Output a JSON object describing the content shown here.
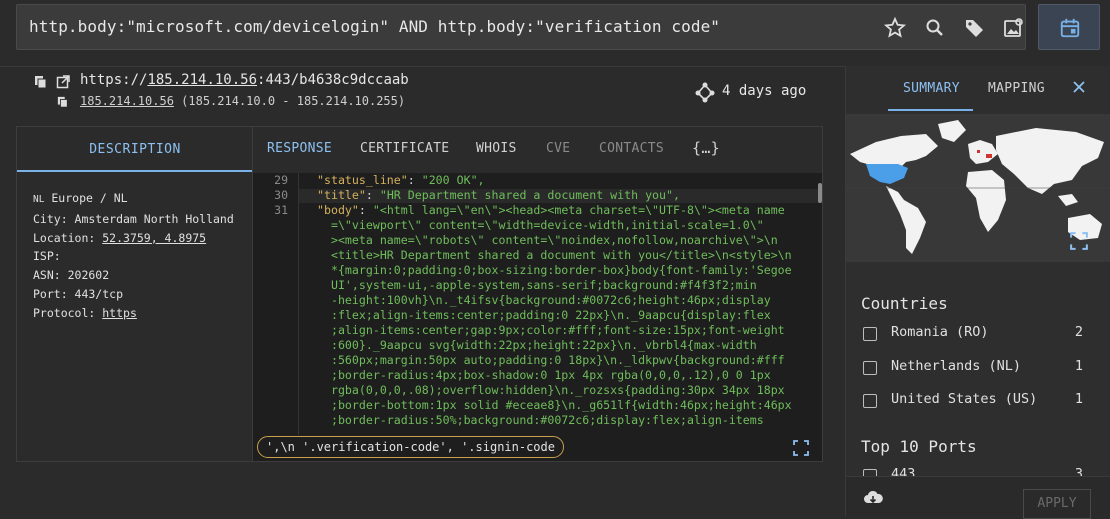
{
  "search": {
    "query": "http.body:\"microsoft.com/devicelogin\" AND http.body:\"verification code\""
  },
  "host": {
    "url_prefix": "https://",
    "url_ip": "185.214.10.56",
    "url_suffix": ":443/b4638c9dccaab",
    "sub_ip": "185.214.10.56",
    "sub_range": " (185.214.10.0 - 185.214.10.255)",
    "age": "4 days ago"
  },
  "left": {
    "tab": "DESCRIPTION",
    "country_code": "NL",
    "region": " Europe / NL",
    "city": "City: Amsterdam North Holland",
    "location_label": "Location: ",
    "location_value": "52.3759, 4.8975",
    "isp": "ISP:",
    "asn": "ASN: 202602",
    "port": "Port: 443/tcp",
    "protocol_label": "Protocol: ",
    "protocol_value": "https"
  },
  "tabs": [
    "RESPONSE",
    "CERTIFICATE",
    "WHOIS",
    "CVE",
    "CONTACTS",
    "{…}"
  ],
  "code": {
    "line_numbers": [
      "29",
      "30",
      "31"
    ],
    "lines": [
      "\"status_line\": \"200 OK\",",
      "\"title\": \"HR Department shared a document with you\",",
      "\"body\": \"<html lang=\\\"en\\\"><head><meta charset=\\\"UTF-8\\\"><meta name",
      "  =\\\"viewport\\\" content=\\\"width=device-width,initial-scale=1.0\\\"",
      "  ><meta name=\\\"robots\\\" content=\\\"noindex,nofollow,noarchive\\\">\\n",
      "  <title>HR Department shared a document with you</title>\\n<style>\\n",
      "  *{margin:0;padding:0;box-sizing:border-box}body{font-family:'Segoe",
      "  UI',system-ui,-apple-system,sans-serif;background:#f4f3f2;min",
      "  -height:100vh}\\n._t4ifsv{background:#0072c6;height:46px;display",
      "  :flex;align-items:center;padding:0 22px}\\n._9aapcu{display:flex",
      "  ;align-items:center;gap:9px;color:#fff;font-size:15px;font-weight",
      "  :600}._9aapcu svg{width:22px;height:22px}\\n._vbrbl4{max-width",
      "  :560px;margin:50px auto;padding:0 18px}\\n._ldkpwv{background:#fff",
      "  ;border-radius:4px;box-shadow:0 1px 4px rgba(0,0,0,.12),0 0 1px",
      "  rgba(0,0,0,.08);overflow:hidden}\\n._rozsxs{padding:30px 34px 18px",
      "  ;border-bottom:1px solid #eceae8}\\n._g651lf{width:46px;height:46px",
      "  ;border-radius:50%;background:#0072c6;display:flex;align-items"
    ],
    "match": "',\\n '.verification-code', '.signin-code"
  },
  "sidebar": {
    "tab_summary": "SUMMARY",
    "tab_mapping": "MAPPING",
    "countries_title": "Countries",
    "countries": [
      {
        "label": "Romania (RO)",
        "count": "2"
      },
      {
        "label": "Netherlands (NL)",
        "count": "1"
      },
      {
        "label": "United States (US)",
        "count": "1"
      }
    ],
    "ports_title": "Top 10 Ports",
    "ports": [
      {
        "label": "443",
        "count": "3"
      }
    ],
    "apply": "APPLY"
  },
  "colors": {
    "accent": "#7ab1e6",
    "highlight_us": "#4a9fe8",
    "match_border": "#c9a04c",
    "code_string": "#6fbd5b"
  }
}
